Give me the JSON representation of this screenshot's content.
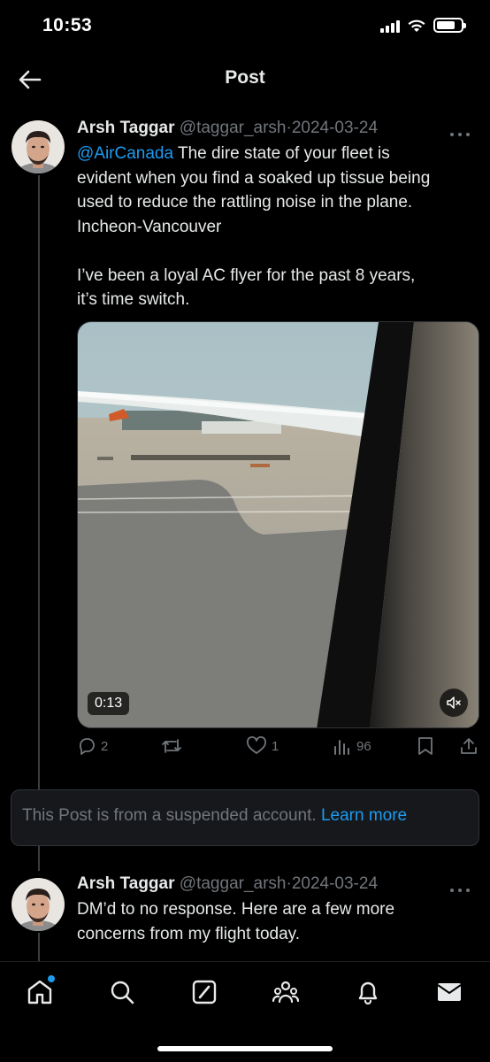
{
  "status_bar": {
    "time": "10:53"
  },
  "header": {
    "title": "Post"
  },
  "tweets": [
    {
      "name": "Arsh Taggar",
      "handle": "@taggar_arsh",
      "separator": "·",
      "date": "2024-03-24",
      "mention": "@AirCanada",
      "text_line_1_rest": " The dire state of your fleet is",
      "text_line_2": "evident when you find a soaked up tissue being",
      "text_line_3": "used to reduce the rattling noise in the plane.",
      "text_line_4": "Incheon-Vancouver",
      "text_line_5": "I’ve been a loyal AC flyer for the past 8 years,",
      "text_line_6": "it’s time switch.",
      "media": {
        "duration": "0:13"
      },
      "stats": {
        "replies": "2",
        "reposts": "",
        "likes": "1",
        "views": "96"
      }
    },
    {
      "name": "Arsh Taggar",
      "handle": "@taggar_arsh",
      "separator": "·",
      "date": "2024-03-24",
      "text_line_1": "DM’d to no response. Here are a few more",
      "text_line_2": "concerns from my flight today."
    }
  ],
  "notice": {
    "text": "This Post is from a suspended account.",
    "link": "Learn more"
  },
  "colors": {
    "accent": "#1d9bf0",
    "muted": "#71767b",
    "background": "#000000",
    "text": "#e7e9ea"
  },
  "tabbar": {
    "items": [
      "home-icon",
      "search-icon",
      "grok-icon",
      "communities-icon",
      "notifications-icon",
      "messages-icon"
    ]
  }
}
